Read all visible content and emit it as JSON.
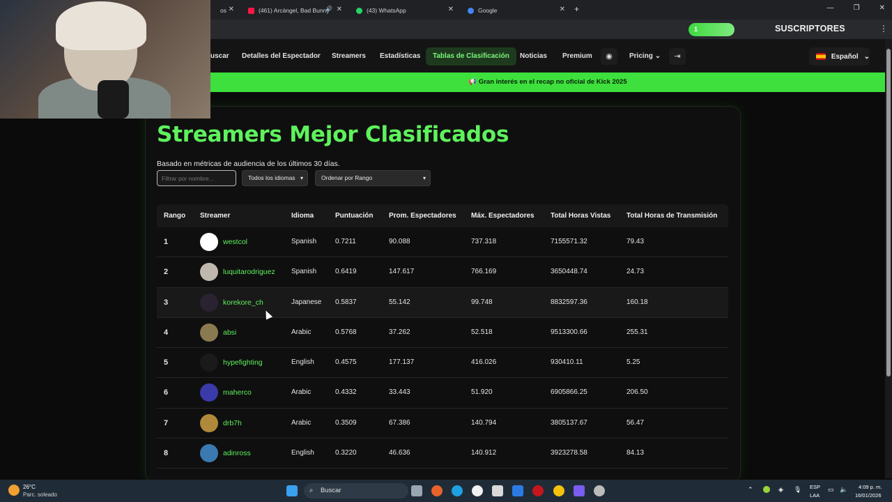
{
  "browser": {
    "tabs": [
      {
        "title": "os",
        "color": "#9aa0a6"
      },
      {
        "title": "(461) Arcángel, Bad Bunny",
        "color": "#ff1744"
      },
      {
        "title": "(43) WhatsApp",
        "color": "#25d366"
      },
      {
        "title": "Google",
        "color": "#4285f4"
      }
    ],
    "new_tab": "+",
    "subscribers_count": "1",
    "subscribers_label": "SUSCRIPTORES"
  },
  "nav": {
    "items": [
      "uscar",
      "Detalles del Espectador",
      "Streamers",
      "Estadísticas",
      "Tablas de Clasificación",
      "Noticias",
      "Premium"
    ],
    "pricing": "Pricing",
    "language": "Español"
  },
  "banner": {
    "text": "Gran interés en el recap no oficial de Kick 2025"
  },
  "page": {
    "title": "Streamers Mejor Clasificados",
    "subtitle": "Basado en métricas de audiencia de los últimos 30 días.",
    "filter_placeholder": "Filtrar por nombre...",
    "language_select": "Todos los idiomas",
    "sort_select": "Ordenar por Rango"
  },
  "table": {
    "headers": [
      "Rango",
      "Streamer",
      "Idioma",
      "Puntuación",
      "Prom. Espectadores",
      "Máx. Espectadores",
      "Total Horas Vistas",
      "Total Horas de Transmisión"
    ],
    "rows": [
      {
        "rank": "1",
        "name": "westcol",
        "lang": "Spanish",
        "score": "0.7211",
        "avg": "90.088",
        "max": "737.318",
        "hours_watched": "7155571.32",
        "hours_streamed": "79.43",
        "avatar_color": "#ffffff"
      },
      {
        "rank": "2",
        "name": "luquitarodriguez",
        "lang": "Spanish",
        "score": "0.6419",
        "avg": "147.617",
        "max": "766.169",
        "hours_watched": "3650448.74",
        "hours_streamed": "24.73",
        "avatar_color": "#bfb8ae"
      },
      {
        "rank": "3",
        "name": "korekore_ch",
        "lang": "Japanese",
        "score": "0.5837",
        "avg": "55.142",
        "max": "99.748",
        "hours_watched": "8832597.36",
        "hours_streamed": "160.18",
        "avatar_color": "#2a2230"
      },
      {
        "rank": "4",
        "name": "absi",
        "lang": "Arabic",
        "score": "0.5768",
        "avg": "37.262",
        "max": "52.518",
        "hours_watched": "9513300.66",
        "hours_streamed": "255.31",
        "avatar_color": "#8a7a50"
      },
      {
        "rank": "5",
        "name": "hypefighting",
        "lang": "English",
        "score": "0.4575",
        "avg": "177.137",
        "max": "416.026",
        "hours_watched": "930410.11",
        "hours_streamed": "5.25",
        "avatar_color": "#1a1a1a"
      },
      {
        "rank": "6",
        "name": "maherco",
        "lang": "Arabic",
        "score": "0.4332",
        "avg": "33.443",
        "max": "51.920",
        "hours_watched": "6905866.25",
        "hours_streamed": "206.50",
        "avatar_color": "#3a3aa8"
      },
      {
        "rank": "7",
        "name": "drb7h",
        "lang": "Arabic",
        "score": "0.3509",
        "avg": "67.386",
        "max": "140.794",
        "hours_watched": "3805137.67",
        "hours_streamed": "56.47",
        "avatar_color": "#b08a3a"
      },
      {
        "rank": "8",
        "name": "adinross",
        "lang": "English",
        "score": "0.3220",
        "avg": "46.636",
        "max": "140.912",
        "hours_watched": "3923278.58",
        "hours_streamed": "84.13",
        "avatar_color": "#3a7ab0"
      }
    ]
  },
  "taskbar": {
    "temp": "26°C",
    "weather": "Parc. soleado",
    "search": "Buscar",
    "lang1": "ESP",
    "lang2": "LAA",
    "time": "4:09 p. m.",
    "date": "16/01/2026"
  }
}
